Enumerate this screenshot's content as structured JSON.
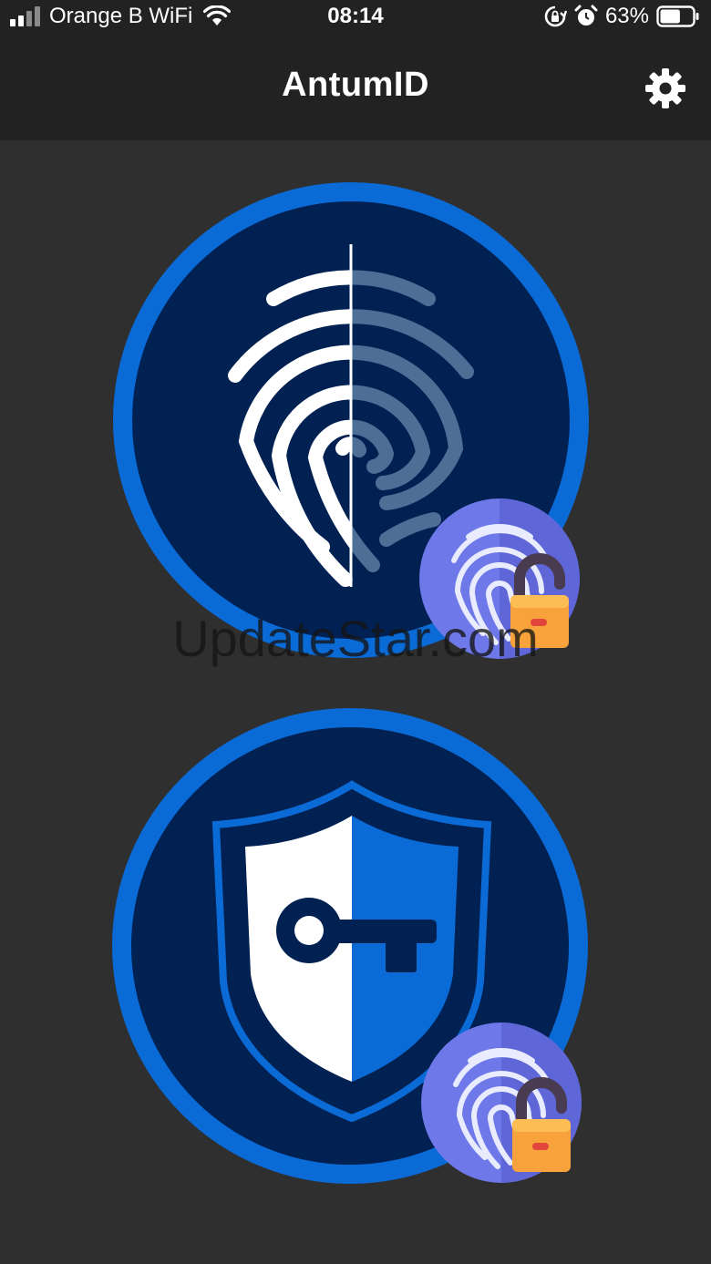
{
  "status_bar": {
    "carrier": "Orange B WiFi",
    "time": "08:14",
    "battery_percent": "63%",
    "battery_level": 0.63,
    "icons": [
      "signal-icon",
      "wifi-icon",
      "rotation-lock-icon",
      "alarm-icon",
      "battery-icon"
    ]
  },
  "app_bar": {
    "title": "AntumID",
    "settings_icon": "gear-icon"
  },
  "main": {
    "buttons": [
      {
        "name": "fingerprint-authentication",
        "icon": "fingerprint-icon",
        "badge_icon": "fingerprint-unlock-icon"
      },
      {
        "name": "password-manager",
        "icon": "shield-key-icon",
        "badge_icon": "fingerprint-unlock-icon"
      }
    ]
  },
  "watermark": "UpdateStar.com",
  "colors": {
    "background": "#2f2f2f",
    "bar": "#222222",
    "circle_outer": "#0a6ad6",
    "circle_inner": "#002152",
    "shield_blue": "#0a6ad6",
    "badge_purple": "#6e78e8",
    "lock_orange": "#f7a23b"
  }
}
